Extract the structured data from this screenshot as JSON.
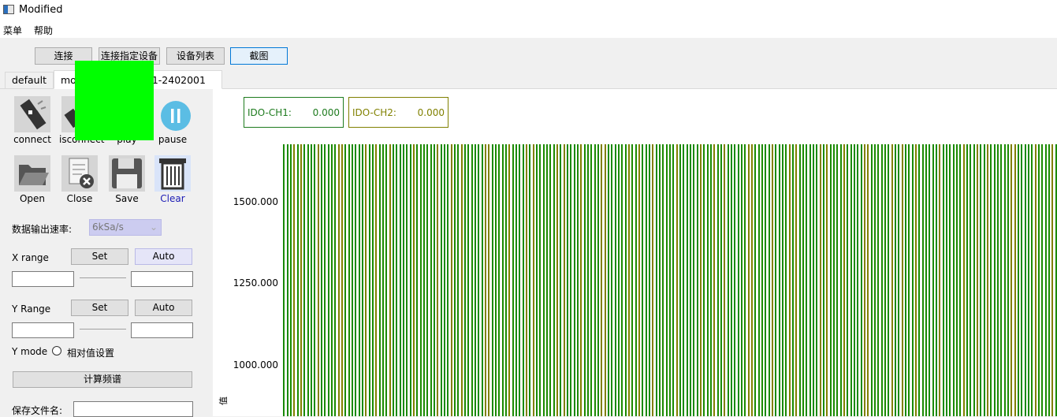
{
  "window": {
    "title": "Modified"
  },
  "menu": {
    "items": [
      "菜单",
      "帮助"
    ]
  },
  "toolbar": {
    "connect": "连接",
    "connect_specific": "连接指定设备",
    "device_list": "设备列表",
    "screenshot": "截图"
  },
  "tabs": [
    {
      "label": "default"
    },
    {
      "label": "mo",
      "label_suffix": "1-2402001"
    }
  ],
  "controls": {
    "icon_buttons": [
      {
        "label": "connect",
        "icon": "connect-plug-icon"
      },
      {
        "label": "isconnect",
        "icon": "disconnect-plug-icon"
      },
      {
        "label": "play",
        "icon": "play-icon"
      },
      {
        "label": "pause",
        "icon": "pause-icon"
      },
      {
        "label": "Open",
        "icon": "folder-open-icon"
      },
      {
        "label": "Close",
        "icon": "close-file-icon"
      },
      {
        "label": "Save",
        "icon": "floppy-disk-icon"
      },
      {
        "label": "Clear",
        "icon": "trash-bin-icon"
      }
    ],
    "output_rate_label": "数据输出速率:",
    "output_rate_value": "6kSa/s",
    "x_range_label": "X range",
    "y_range_label": "Y Range",
    "set_label": "Set",
    "auto_label": "Auto",
    "y_mode_label": "Y mode",
    "relative_label": "相对值设置",
    "spectrum_button": "计算频谱",
    "save_filename_label": "保存文件名:"
  },
  "readouts": [
    {
      "name": "IDO-CH1:",
      "value": "0.000",
      "color": "#1e7b1e"
    },
    {
      "name": "IDO-CH2:",
      "value": "0.000",
      "color": "#808000"
    }
  ],
  "chart_data": {
    "type": "line",
    "series": [
      {
        "color": "#1a8a00"
      },
      {
        "color": "#808000"
      }
    ],
    "y_ticks": [
      "1500.000",
      "1250.000",
      "1000.000"
    ],
    "y_axis_label": "值",
    "grid": true
  }
}
